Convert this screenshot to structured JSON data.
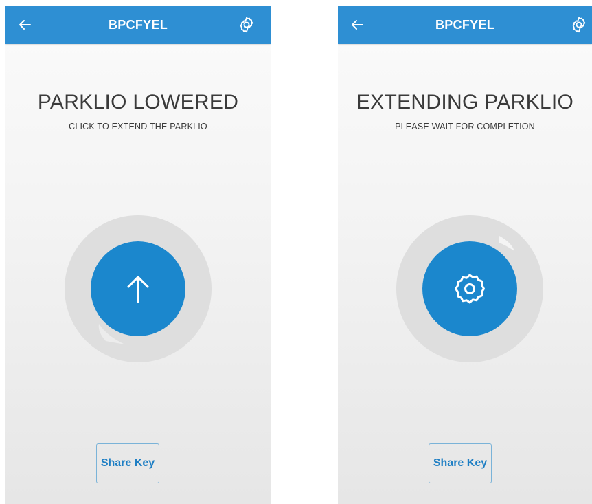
{
  "colors": {
    "accent": "#2e8fd3",
    "button": "#1b87cd",
    "ring": "#dedede"
  },
  "screens": [
    {
      "header": {
        "title": "BPCFYEL",
        "back_icon": "arrow-left-icon",
        "settings_icon": "gear-icon"
      },
      "status": {
        "title": "PARKLIO LOWERED",
        "subtitle": "CLICK TO EXTEND THE PARKLIO"
      },
      "action": {
        "icon": "arrow-up-icon"
      },
      "share_label": "Share Key"
    },
    {
      "header": {
        "title": "BPCFYEL",
        "back_icon": "arrow-left-icon",
        "settings_icon": "gear-icon"
      },
      "status": {
        "title": "EXTENDING PARKLIO",
        "subtitle": "PLEASE WAIT FOR COMPLETION"
      },
      "action": {
        "icon": "gear-icon"
      },
      "share_label": "Share Key"
    }
  ]
}
